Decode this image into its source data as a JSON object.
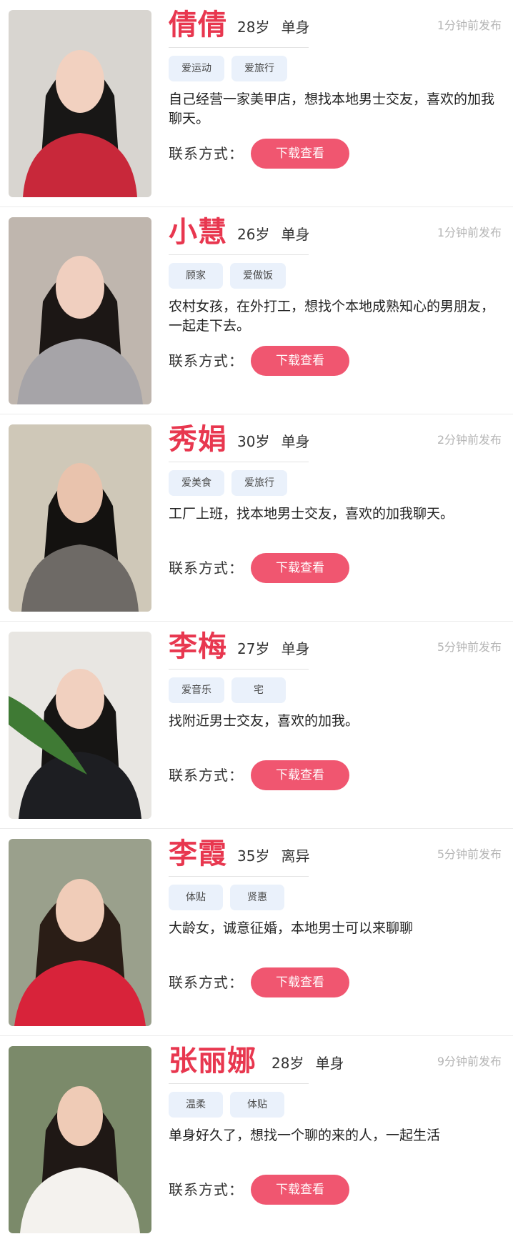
{
  "listings": [
    {
      "name": "倩倩",
      "age": "28岁",
      "status": "单身",
      "time": "1分钟前发布",
      "tags": [
        "爱运动",
        "爱旅行"
      ],
      "desc": "自己经营一家美甲店，想找本地男士交友，喜欢的加我聊天。",
      "contact_label": "联系方式：",
      "button_label": "下载查看",
      "photo": {
        "bg": "#d8d5d0",
        "top": "#c8283a",
        "hair": "#181716",
        "skin": "#f2d1c0"
      }
    },
    {
      "name": "小慧",
      "age": "26岁",
      "status": "单身",
      "time": "1分钟前发布",
      "tags": [
        "顾家",
        "爱做饭"
      ],
      "desc": "农村女孩，在外打工，想找个本地成熟知心的男朋友，一起走下去。",
      "contact_label": "联系方式：",
      "button_label": "下载查看",
      "photo": {
        "bg": "#bfb6ae",
        "top": "#a6a4a8",
        "hair": "#1c1715",
        "skin": "#f0cfbf"
      }
    },
    {
      "name": "秀娟",
      "age": "30岁",
      "status": "单身",
      "time": "2分钟前发布",
      "tags": [
        "爱美食",
        "爱旅行"
      ],
      "desc": "工厂上班，找本地男士交友，喜欢的加我聊天。",
      "contact_label": "联系方式：",
      "button_label": "下载查看",
      "photo": {
        "bg": "#cfc8b8",
        "top": "#6e6a66",
        "hair": "#141210",
        "skin": "#e9c3ad"
      }
    },
    {
      "name": "李梅",
      "age": "27岁",
      "status": "单身",
      "time": "5分钟前发布",
      "tags": [
        "爱音乐",
        "宅"
      ],
      "desc": "找附近男士交友，喜欢的加我。",
      "contact_label": "联系方式：",
      "button_label": "下载查看",
      "photo": {
        "bg": "#e8e6e2",
        "top": "#1d1e22",
        "hair": "#161514",
        "skin": "#f1d0bf"
      }
    },
    {
      "name": "李霞",
      "age": "35岁",
      "status": "离异",
      "time": "5分钟前发布",
      "tags": [
        "体贴",
        "贤惠"
      ],
      "desc": "大龄女，诚意征婚，本地男士可以来聊聊",
      "contact_label": "联系方式：",
      "button_label": "下载查看",
      "photo": {
        "bg": "#9aa08c",
        "top": "#d8233a",
        "hair": "#2a1d16",
        "skin": "#f0ccb8"
      }
    },
    {
      "name": "张丽娜",
      "age": "28岁",
      "status": "单身",
      "time": "9分钟前发布",
      "tags": [
        "温柔",
        "体贴"
      ],
      "desc": "单身好久了，想找一个聊的来的人，一起生活",
      "contact_label": "联系方式：",
      "button_label": "下载查看",
      "photo": {
        "bg": "#7b8a6a",
        "top": "#f4f2ee",
        "hair": "#1f1815",
        "skin": "#efcbb6"
      }
    }
  ]
}
